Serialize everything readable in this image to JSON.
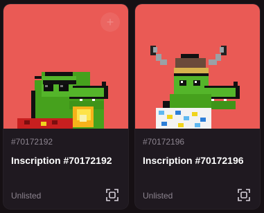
{
  "cards": [
    {
      "number": "#70172192",
      "title": "Inscription #70172192",
      "status": "Unlisted",
      "add_icon": "plus-icon",
      "action_icon": "scan-frame-icon",
      "background": "#ea5a55"
    },
    {
      "number": "#70172196",
      "title": "Inscription #70172196",
      "status": "Unlisted",
      "action_icon": "scan-frame-icon",
      "background": "#ea5a55"
    }
  ],
  "add_button_label": "+"
}
